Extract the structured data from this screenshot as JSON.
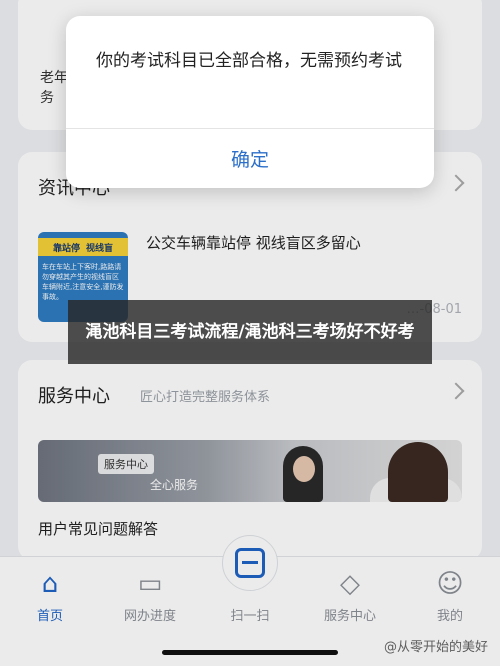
{
  "top_card": {
    "left_label": "老年\n务",
    "right_label": "\n"
  },
  "news": {
    "title": "资讯中心",
    "subtitle": "",
    "item_title": "公交车辆靠站停 视线盲区多留心",
    "thumb_tag_1": "靠站停",
    "thumb_tag_2": "视线盲",
    "thumb_text": "车在车站上下客时,路路请勿穿越其产生的视线盲区车辆附近,注意安全,谨防发事故。",
    "date": "…-08-01"
  },
  "service": {
    "title": "服务中心",
    "subtitle": "匠心打造完整服务体系",
    "banner_tag": "服务中心",
    "banner_text": "全心服务",
    "faq_title": "用户常见问题解答"
  },
  "tabbar": {
    "home": "首页",
    "online": "网办进度",
    "scan": "扫一扫",
    "service": "服务中心",
    "mine": "我的"
  },
  "alert": {
    "message": "你的考试科目已全部合格，无需预约考试",
    "confirm": "确定"
  },
  "overlay_title": "渑池科目三考试流程/渑池科三考场好不好考",
  "watermark": "@从零开始的美好",
  "colors": {
    "accent": "#1f64c7",
    "alert_button": "#2b6fc9"
  }
}
